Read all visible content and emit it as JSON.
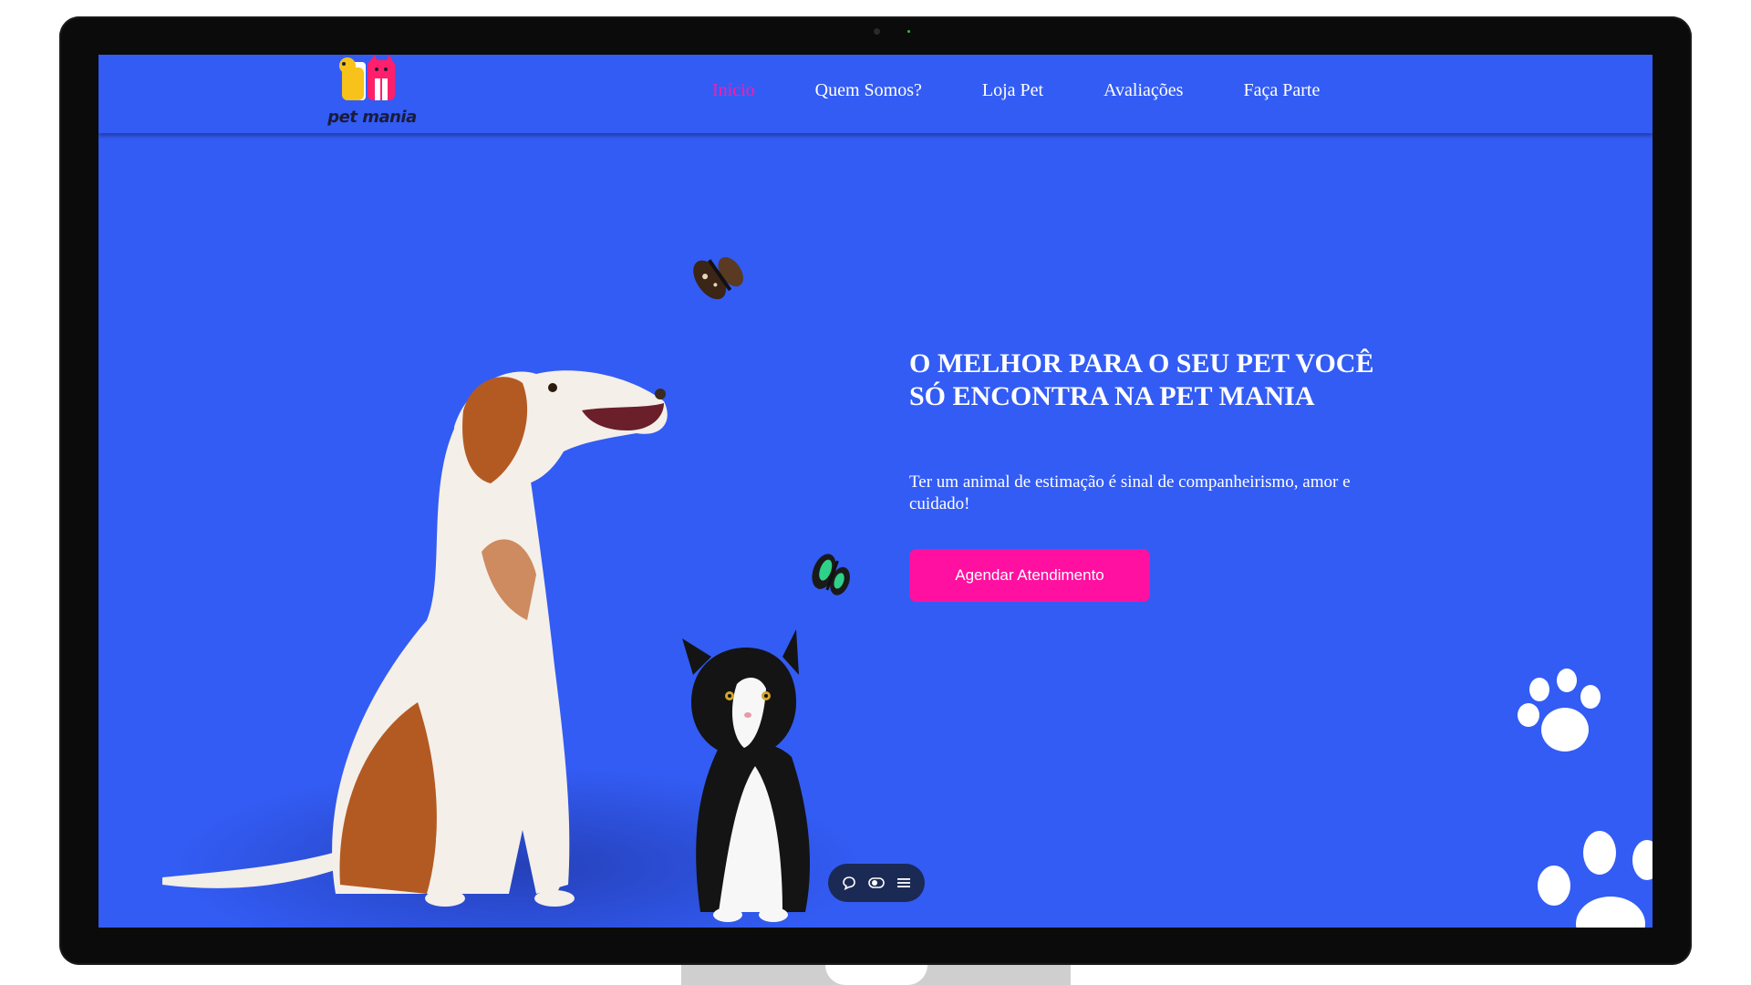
{
  "nav": {
    "logo_text": "pet mania",
    "links": [
      {
        "label": "Início",
        "active": true
      },
      {
        "label": "Quem Somos?",
        "active": false
      },
      {
        "label": "Loja Pet",
        "active": false
      },
      {
        "label": "Avaliações",
        "active": false
      },
      {
        "label": "Faça Parte",
        "active": false
      }
    ]
  },
  "hero": {
    "title": "O MELHOR PARA O SEU PET VOCÊ SÓ ENCONTRA NA PET MANIA",
    "text": "Ter um animal de estimação é sinal de companheirismo, amor e cuidado!",
    "cta_label": "Agendar Atendimento"
  },
  "floating_bar": {
    "icons": [
      "chat-icon",
      "toggle-icon",
      "menu-icon"
    ]
  },
  "colors": {
    "background": "#335cf4",
    "accent": "#ff10a0",
    "text": "#ffffff"
  },
  "decorations": [
    "dog",
    "cat",
    "butterfly",
    "butterfly",
    "paw-print",
    "paw-print"
  ]
}
